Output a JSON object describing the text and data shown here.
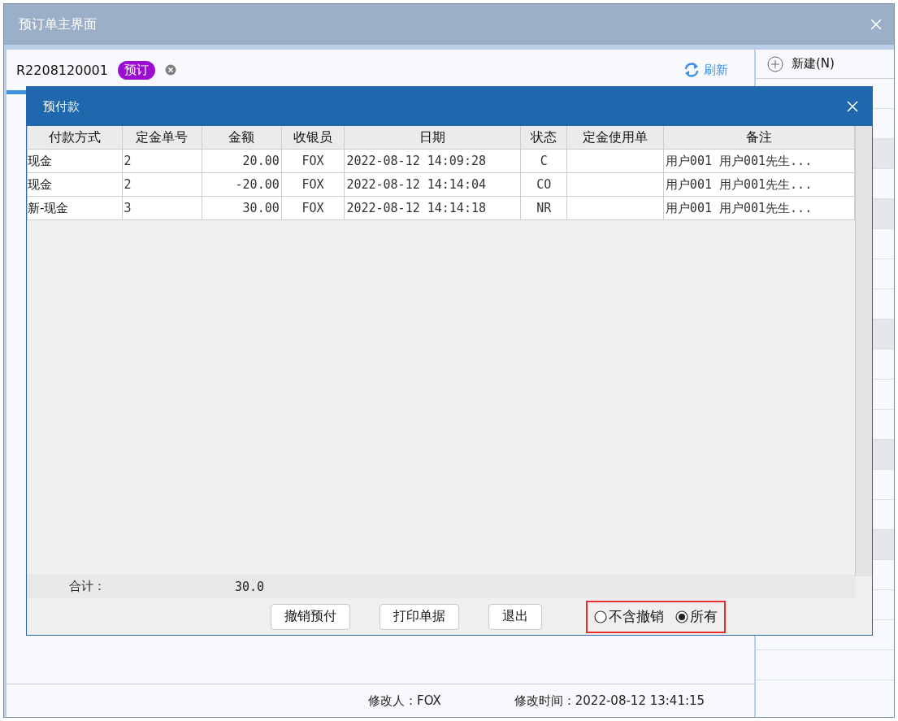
{
  "window": {
    "title": "预订单主界面"
  },
  "tab": {
    "order_no": "R2208120001",
    "badge": "预订"
  },
  "refresh": {
    "label": "刷新"
  },
  "side_panel": {
    "new_button": "新建(N)"
  },
  "dialog": {
    "title": "预付款",
    "table": {
      "columns": [
        "付款方式",
        "定金单号",
        "金额",
        "收银员",
        "日期",
        "状态",
        "定金使用单",
        "备注"
      ],
      "rows": [
        [
          "现金",
          "2",
          "20.00",
          "FOX",
          "2022-08-12 14:09:28",
          "C",
          "",
          "用户001 用户001先生..."
        ],
        [
          "现金",
          "2",
          "-20.00",
          "FOX",
          "2022-08-12 14:14:04",
          "CO",
          "",
          "用户001 用户001先生..."
        ],
        [
          "新-现金",
          "3",
          "30.00",
          "FOX",
          "2022-08-12 14:14:18",
          "NR",
          "",
          "用户001 用户001先生..."
        ]
      ]
    },
    "total_label": "合计：",
    "total_value": "30.0",
    "buttons": [
      "撤销预付",
      "打印单据",
      "退出"
    ],
    "filter": [
      {
        "label": "不含撤销",
        "selected": false
      },
      {
        "label": "所有",
        "selected": true
      }
    ]
  },
  "status_bar": {
    "modifier": "修改人：FOX",
    "modified_time": "修改时间：2022-08-12 13:41:15"
  }
}
